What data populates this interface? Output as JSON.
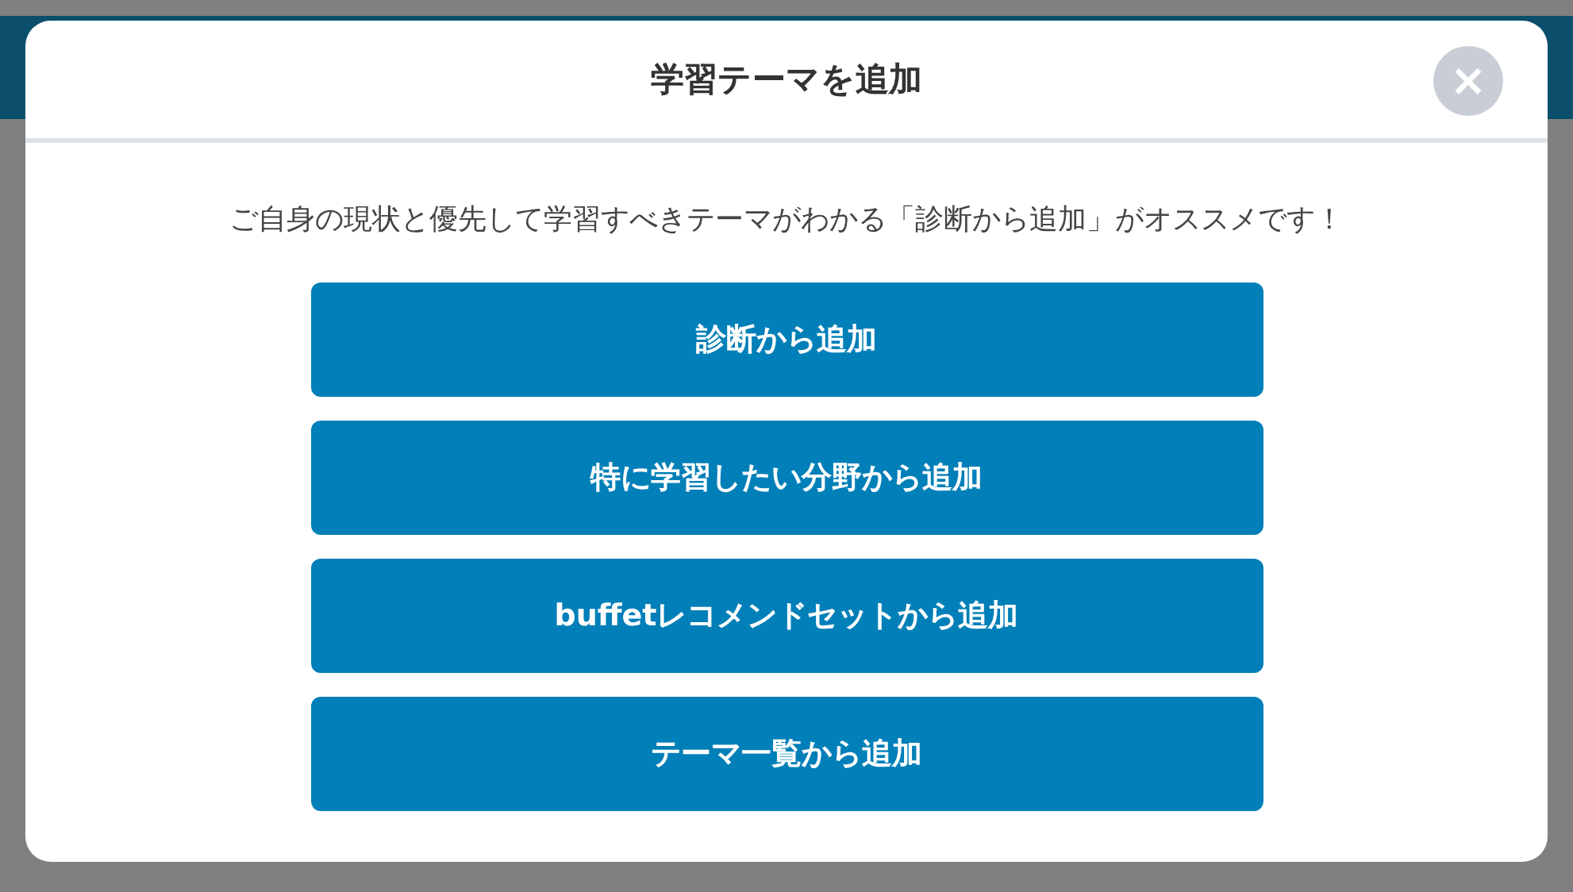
{
  "dialog": {
    "title": "学習テーマを追加",
    "close": "×",
    "message": "ご自身の現状と優先して学習すべきテーマがわかる「診断から追加」がオススメです！",
    "buttons": [
      "診断から追加",
      "特に学習したい分野から追加",
      "buffetレコメンドセットから追加",
      "テーマ一覧から追加"
    ]
  }
}
